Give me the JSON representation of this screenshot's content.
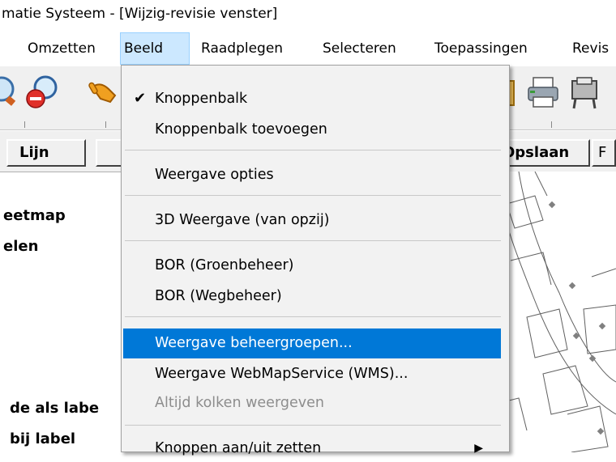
{
  "window": {
    "title": "matie Systeem - [Wijzig-revisie venster]"
  },
  "menubar": {
    "items": [
      {
        "label": "Omzetten"
      },
      {
        "label": "Beeld"
      },
      {
        "label": "Raadplegen"
      },
      {
        "label": "Selecteren"
      },
      {
        "label": "Toepassingen"
      },
      {
        "label": "Revis"
      }
    ],
    "active": "Beeld"
  },
  "toolbar": {
    "icons": [
      "zoom-icon",
      "zoom-out-icon",
      "pan-hand-icon",
      "clipboard-icon",
      "print-icon",
      "plotter-icon"
    ]
  },
  "buttons": {
    "lijn": "Lijn",
    "blank": "",
    "opslaan": "Opslaan",
    "cut": "F"
  },
  "left_panel": {
    "line1": "eetmap",
    "line2": "elen",
    "line3": "de als labe",
    "line4": "bij label"
  },
  "dropdown": {
    "items": [
      {
        "label": "Knoppenbalk",
        "checked": true
      },
      {
        "label": "Knoppenbalk toevoegen"
      },
      {
        "label": "Weergave opties"
      },
      {
        "label": "3D Weergave (van opzij)"
      },
      {
        "label": "BOR (Groenbeheer)"
      },
      {
        "label": "BOR (Wegbeheer)"
      },
      {
        "label": "Weergave beheergroepen...",
        "highlighted": true
      },
      {
        "label": "Weergave WebMapService (WMS)..."
      },
      {
        "label": "Altijd kolken weergeven",
        "disabled": true
      },
      {
        "label": "Knoppen aan/uit zetten",
        "submenu": true
      }
    ],
    "check_glyph": "✔",
    "submenu_glyph": "▶"
  },
  "colors": {
    "highlight": "#0078d7",
    "menu_active_bg": "#cce8ff",
    "disabled_text": "#8d8d8d"
  }
}
